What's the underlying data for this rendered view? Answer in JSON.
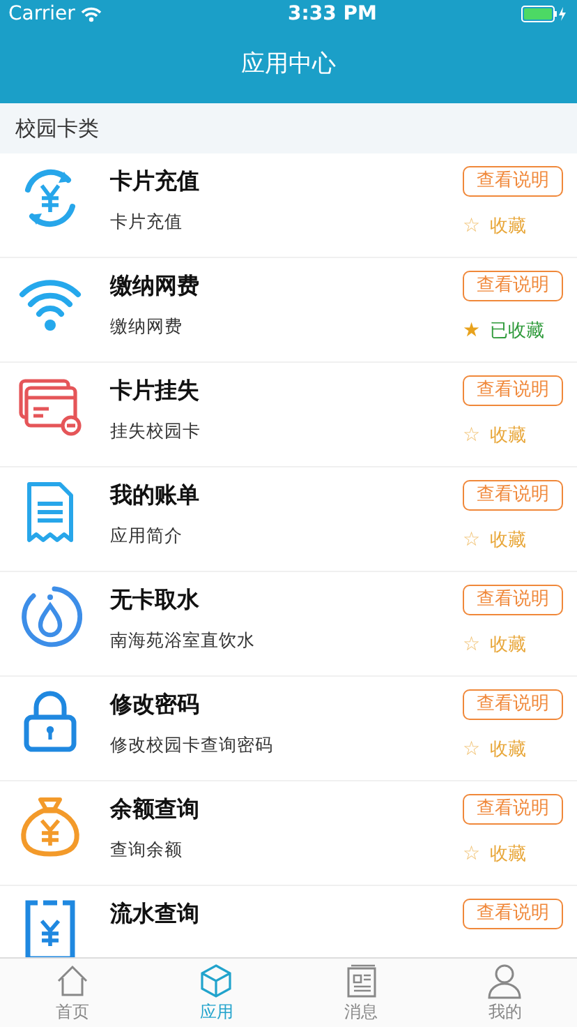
{
  "status_bar": {
    "carrier": "Carrier",
    "time": "3:33 PM"
  },
  "nav_bar": {
    "title": "应用中心"
  },
  "section": {
    "title": "校园卡类"
  },
  "apps": [
    {
      "kind": "recharge",
      "title": "卡片充值",
      "subtitle": "卡片充值",
      "button": "查看说明",
      "favorite": {
        "label": "收藏",
        "star": "☆",
        "favorited": false
      }
    },
    {
      "kind": "wifi",
      "title": "缴纳网费",
      "subtitle": "缴纳网费",
      "button": "查看说明",
      "favorite": {
        "label": "已收藏",
        "star": "★",
        "favorited": true
      }
    },
    {
      "kind": "card",
      "title": "卡片挂失",
      "subtitle": "挂失校园卡",
      "button": "查看说明",
      "favorite": {
        "label": "收藏",
        "star": "☆",
        "favorited": false
      }
    },
    {
      "kind": "bill",
      "title": "我的账单",
      "subtitle": "应用简介",
      "button": "查看说明",
      "favorite": {
        "label": "收藏",
        "star": "☆",
        "favorited": false
      }
    },
    {
      "kind": "water",
      "title": "无卡取水",
      "subtitle": "南海苑浴室直饮水",
      "button": "查看说明",
      "favorite": {
        "label": "收藏",
        "star": "☆",
        "favorited": false
      }
    },
    {
      "kind": "lock",
      "title": "修改密码",
      "subtitle": "修改校园卡查询密码",
      "button": "查看说明",
      "favorite": {
        "label": "收藏",
        "star": "☆",
        "favorited": false
      }
    },
    {
      "kind": "balance",
      "title": "余额查询",
      "subtitle": "查询余额",
      "button": "查看说明",
      "favorite": {
        "label": "收藏",
        "star": "☆",
        "favorited": false
      }
    },
    {
      "kind": "statement",
      "title": "流水查询",
      "button": "查看说明"
    }
  ],
  "tab_bar": [
    {
      "kind": "home",
      "label": "首页",
      "selected": false
    },
    {
      "kind": "apps",
      "label": "应用",
      "selected": true
    },
    {
      "kind": "messages",
      "label": "消息",
      "selected": false
    },
    {
      "kind": "profile",
      "label": "我的",
      "selected": false
    }
  ]
}
